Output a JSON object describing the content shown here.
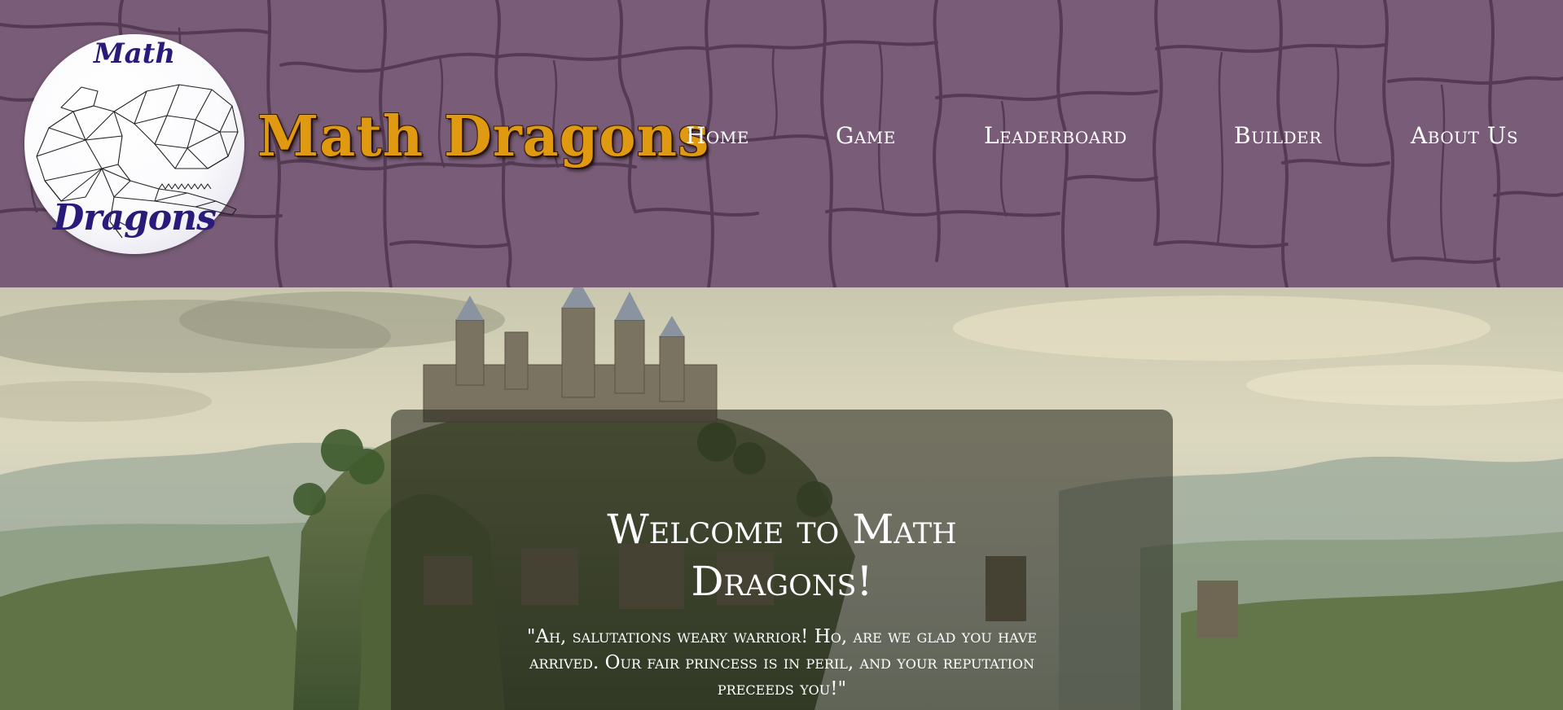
{
  "header": {
    "logo": {
      "top_word": "Math",
      "bottom_word": "Dragons",
      "icon": "dragon-icon"
    },
    "site_title": "Math Dragons",
    "nav": [
      {
        "label": "Home"
      },
      {
        "label": "Game"
      },
      {
        "label": "Leaderboard"
      },
      {
        "label": "Builder"
      },
      {
        "label": "About Us"
      }
    ]
  },
  "hero": {
    "background": "castle-landscape-painting",
    "welcome_title": "Welcome to Math Dragons!",
    "welcome_quote": "\"Ah, salutations weary warrior! Ho, are we glad you have arrived. Our fair princess is in peril, and your reputation preceeds you!\""
  },
  "colors": {
    "header_bg": "#795d78",
    "crack_color": "#5a3f58",
    "title_gold": "#e09a12",
    "logo_text": "#2a1a7a",
    "nav_text": "#ffffff"
  }
}
